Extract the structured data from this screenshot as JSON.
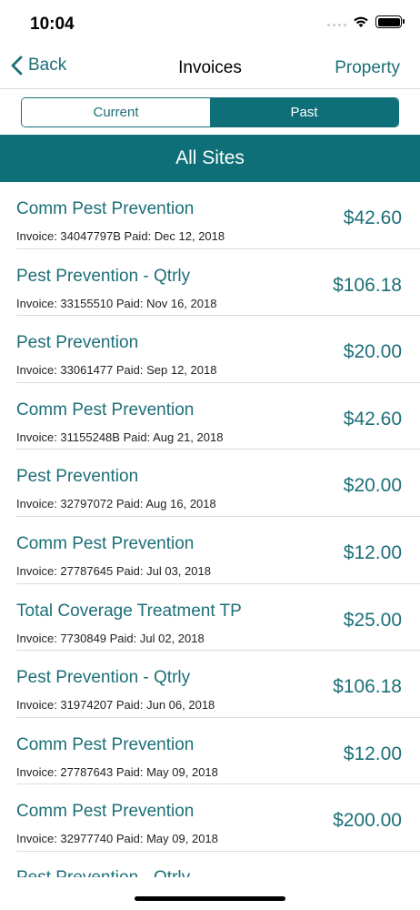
{
  "status_bar": {
    "time": "10:04"
  },
  "nav": {
    "back_label": "Back",
    "title": "Invoices",
    "right_label": "Property"
  },
  "segments": {
    "current_label": "Current",
    "past_label": "Past"
  },
  "banner": {
    "title": "All Sites"
  },
  "invoices": [
    {
      "title": "Comm Pest Prevention",
      "meta": "Invoice: 34047797B  Paid: Dec 12, 2018",
      "amount": "$42.60"
    },
    {
      "title": "Pest Prevention - Qtrly",
      "meta": "Invoice: 33155510  Paid: Nov 16, 2018",
      "amount": "$106.18"
    },
    {
      "title": "Pest Prevention",
      "meta": "Invoice: 33061477  Paid: Sep 12, 2018",
      "amount": "$20.00"
    },
    {
      "title": "Comm Pest Prevention",
      "meta": "Invoice: 31155248B  Paid: Aug 21, 2018",
      "amount": "$42.60"
    },
    {
      "title": "Pest Prevention",
      "meta": "Invoice: 32797072  Paid: Aug 16, 2018",
      "amount": "$20.00"
    },
    {
      "title": "Comm Pest Prevention",
      "meta": "Invoice: 27787645  Paid: Jul 03, 2018",
      "amount": "$12.00"
    },
    {
      "title": "Total Coverage Treatment TP",
      "meta": "Invoice: 7730849  Paid: Jul 02, 2018",
      "amount": "$25.00"
    },
    {
      "title": "Pest Prevention - Qtrly",
      "meta": "Invoice: 31974207  Paid: Jun 06, 2018",
      "amount": "$106.18"
    },
    {
      "title": "Comm Pest Prevention",
      "meta": "Invoice: 27787643  Paid: May 09, 2018",
      "amount": "$12.00"
    },
    {
      "title": "Comm Pest Prevention",
      "meta": "Invoice: 32977740  Paid: May 09, 2018",
      "amount": "$200.00"
    }
  ],
  "partial_item": {
    "title": "Pest Prevention - Qtrly"
  },
  "colors": {
    "accent": "#0e6f78",
    "text_accent": "#1d6f78"
  },
  "icons": [
    "chevron-left-icon",
    "signal-icon",
    "wifi-icon",
    "battery-icon"
  ]
}
